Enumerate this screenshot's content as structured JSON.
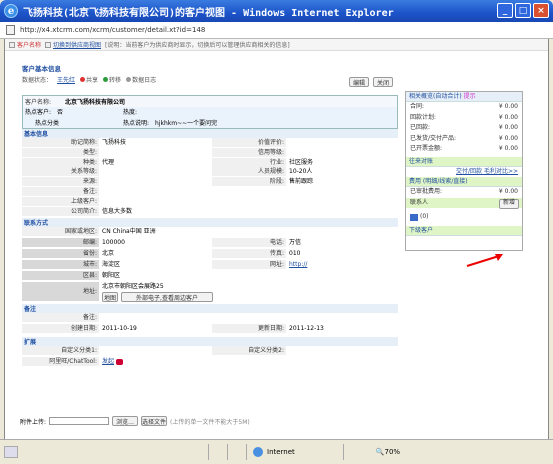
{
  "window": {
    "title": "飞扬科技(北京飞扬科技有限公司)的客户视图 - Windows Internet Explorer",
    "icon": "ie-icon",
    "buttons": [
      "minimize",
      "restore",
      "close"
    ]
  },
  "address": {
    "url": "http://x4.xtcrm.com/xcrm/customer/detail.xt?id=148"
  },
  "toolbar": {
    "item1": "客户名称",
    "item2": "切换到供应商视图",
    "hint": "[说明：当前客户为供应商时显示，切换后可以管理供应商相关的信息]"
  },
  "main": {
    "section_title": "客户基本信息",
    "meta_label": "数据状态：",
    "meta_owner": "王先红",
    "meta_opt1": "共享",
    "meta_opt2": "转移",
    "meta_opt3": "数据日志",
    "edit_button": "编辑",
    "close_button": "关闭",
    "customer_label": "客户名称:",
    "customer_name": "北京飞扬科技有限公司",
    "hot_label": "热点客户:",
    "hot_value": "否",
    "hot2_label": "热度:",
    "hot2_value": "",
    "class_label": "热点分类",
    "class_value": "",
    "desc_label": "热点说明:",
    "desc_value": "hjkhkm~~一个要问完",
    "basic_band": "基本信息",
    "f_abbr_label": "助记简称:",
    "f_abbr": "飞扬科技",
    "f_price_label": "价值评价:",
    "f_price": "",
    "f_type_label": "类型:",
    "f_type": "",
    "f_credit_label": "信用等级:",
    "f_credit": "",
    "f_kind_label": "种类:",
    "f_kind": "代理",
    "f_industry_label": "行业:",
    "f_industry": "社区服务",
    "f_rel_label": "关系等级:",
    "f_rel": "",
    "f_staff_label": "人员规模:",
    "f_staff": "10-20人",
    "f_src_label": "来源:",
    "f_src": "",
    "f_stage_label": "阶段:",
    "f_stage": "售前跟踪",
    "f_note_label": "备注:",
    "f_note": "",
    "f_parent_label": "上级客户:",
    "f_parent": "",
    "f_intro_label": "公司简介:",
    "f_intro": "信息大多数",
    "contact_band": "联系方式",
    "c_region_label": "国家或地区:",
    "c_region": "CN China中国 亚洲",
    "c_zip_label": "邮编:",
    "c_zip": "100000",
    "c_tel_label": "电话:",
    "c_tel": "万信",
    "c_prov_label": "省份:",
    "c_prov": "北京",
    "c_fax_label": "传真:",
    "c_fax": "010",
    "c_city_label": "城市:",
    "c_city": "海淀区",
    "c_web_label": "网址:",
    "c_web": "http://",
    "c_area_label": "区县:",
    "c_area": "朝阳区",
    "c_addr_label": "地址:",
    "c_addr": "北京市朝阳区会展路25",
    "c_btn1": "地图",
    "c_btn2": "外部电子,查看周边客户",
    "memo_band": "备注",
    "memo_label": "备注:",
    "memo": "",
    "create_label": "创建日期:",
    "create": "2011-10-19",
    "update_label": "更新日期:",
    "update": "2011-12-13",
    "ext_band": "扩展",
    "ext1_label": "自定义分类1:",
    "ext1": "",
    "ext2_label": "自定义分类2:",
    "ext2": "",
    "chat_label": "阿里旺/ChatTool:",
    "chat": "发起",
    "upload_label": "附件上传:",
    "upload_btn": "浏览...",
    "upload_btn2": "选择文件",
    "upload_hint": "(上传的单一文件不能大于5M)"
  },
  "side": {
    "header1": "相关概览(自动合计)",
    "header1_tag": "提示",
    "rows": [
      {
        "k": "合同:",
        "v": "¥ 0.00"
      },
      {
        "k": "回款计划:",
        "v": "¥ 0.00"
      },
      {
        "k": "已回款:",
        "v": "¥ 0.00"
      },
      {
        "k": "已发货/交付产品:",
        "v": "¥ 0.00"
      },
      {
        "k": "已开票金额:",
        "v": "¥ 0.00"
      }
    ],
    "header2": "往来对账",
    "link2": "交付/回款 毛利对比>>",
    "header3": "费用 (明细/线索/直接)",
    "fee_label": "已审批费用:",
    "fee": "¥ 0.00",
    "contact_label": "联系人",
    "contact_btn": "新增",
    "header4": "下级客户",
    "icon_label": "(0)"
  },
  "statusbar": {
    "zone": "Internet",
    "zoom": "70%"
  },
  "colors": {
    "title": "#1c54c9",
    "accent": "#1f4fa0",
    "green": "#dff5c6"
  }
}
